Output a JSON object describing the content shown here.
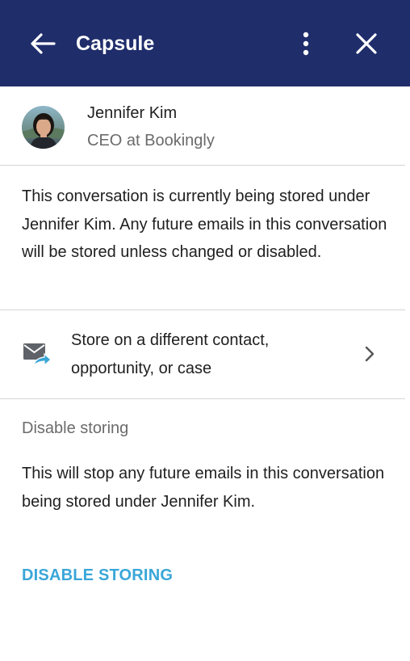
{
  "header": {
    "title": "Capsule",
    "back_icon": "arrow-left-icon",
    "menu_icon": "more-vertical-icon",
    "close_icon": "close-icon",
    "background_color": "#1f2d6b"
  },
  "contact": {
    "name": "Jennifer Kim",
    "role": "CEO at Bookingly",
    "avatar_icon": "avatar"
  },
  "info": {
    "text": "This conversation is currently being stored under Jennifer Kim. Any future emails in this conversation will be stored unless changed or disabled."
  },
  "store_option": {
    "label": "Store on a different contact, opportunity, or case",
    "icon": "email-forward-icon",
    "chevron_icon": "chevron-right-icon"
  },
  "disable_section": {
    "label": "Disable storing",
    "description": "This will stop any future emails in this conversation being stored under Jennifer Kim.",
    "button_label": "DISABLE STORING",
    "button_color": "#3aa6d8"
  }
}
